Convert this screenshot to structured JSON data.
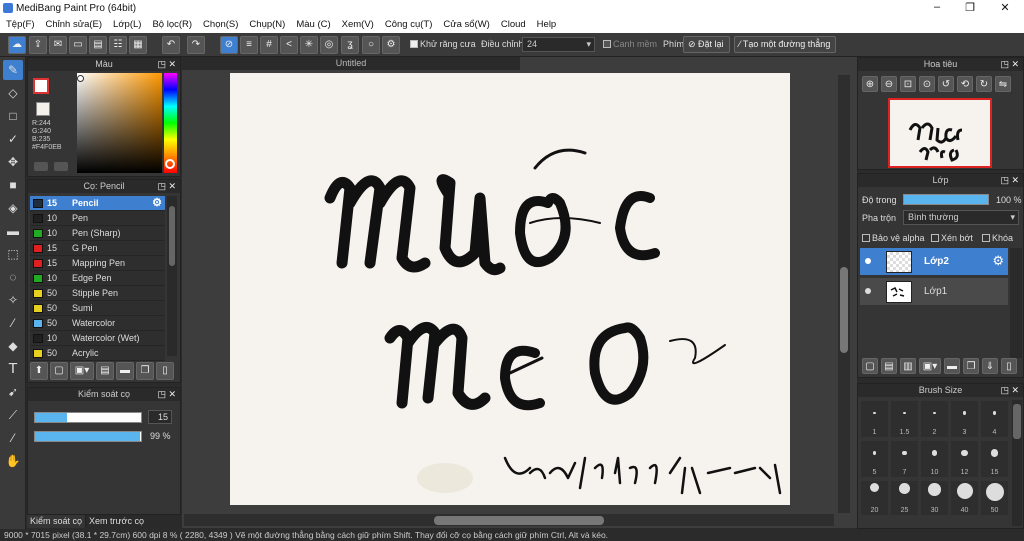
{
  "window": {
    "title": "MediBang Paint Pro (64bit)"
  },
  "menu": [
    "Tệp(F)",
    "Chỉnh sửa(E)",
    "Lớp(L)",
    "Bộ lọc(R)",
    "Chọn(S)",
    "Chụp(N)",
    "Màu (C)",
    "Xem(V)",
    "Công cụ(T)",
    "Cửa sổ(W)",
    "Cloud",
    "Help"
  ],
  "toolbar": {
    "antialias": "Khử răng cưa",
    "correction_label": "Điều chỉnh",
    "correction_value": "24",
    "edge_mode": "Canh mềm",
    "key_label": "Phím",
    "reset": "Đặt lại",
    "straight_line": "Tạo một đường thẳng"
  },
  "color_panel": {
    "title": "Màu",
    "r": "R:244",
    "g": "G:240",
    "b": "B:235",
    "hex": "#F4F0EB",
    "fg": "#F4F0EB"
  },
  "brush_panel": {
    "title": "Cọ: Pencil",
    "items": [
      {
        "size": "15",
        "name": "Pencil",
        "color": "#1e2e3e"
      },
      {
        "size": "10",
        "name": "Pen",
        "color": "#202020"
      },
      {
        "size": "10",
        "name": "Pen (Sharp)",
        "color": "#22aa22"
      },
      {
        "size": "15",
        "name": "G Pen",
        "color": "#e02020"
      },
      {
        "size": "15",
        "name": "Mapping Pen",
        "color": "#e02020"
      },
      {
        "size": "10",
        "name": "Edge Pen",
        "color": "#22aa22"
      },
      {
        "size": "50",
        "name": "Stipple Pen",
        "color": "#e8d020"
      },
      {
        "size": "50",
        "name": "Sumi",
        "color": "#e8d020"
      },
      {
        "size": "50",
        "name": "Watercolor",
        "color": "#5ab4ee"
      },
      {
        "size": "10",
        "name": "Watercolor (Wet)",
        "color": "#202020"
      },
      {
        "size": "50",
        "name": "Acrylic",
        "color": "#e8d020"
      }
    ]
  },
  "brush_control": {
    "title": "Kiểm soát cọ",
    "size": "15",
    "opacity": "99 %",
    "opacity_fraction": 0.99
  },
  "bottom_tabs": [
    "Kiểm soát cọ",
    "Xem trước cọ"
  ],
  "document": {
    "tab": "Untitled"
  },
  "navigator": {
    "title": "Hoa tiêu"
  },
  "layer_panel": {
    "title": "Lớp",
    "opacity_label": "Độ trong",
    "opacity_value": "100 %",
    "blend_label": "Pha trộn",
    "blend_value": "Bình thường",
    "protect_alpha": "Bảo vệ alpha",
    "clipping": "Xén bớt",
    "lock": "Khóa",
    "layers": [
      {
        "name": "Lớp2",
        "active": true
      },
      {
        "name": "Lớp1",
        "active": false
      }
    ]
  },
  "brush_size_panel": {
    "title": "Brush Size",
    "sizes": [
      "1",
      "1.5",
      "2",
      "3",
      "4",
      "5",
      "7",
      "10",
      "12",
      "15",
      "20",
      "25",
      "30",
      "40",
      "50"
    ]
  },
  "status": "9000 * 7015 pixel   (38.1 * 29.7cm)   600 dpi   8 %   ( 2280, 4349 )   Vẽ một đường thẳng bằng cách giữ phím Shift. Thay đổi cỡ cọ bằng cách giữ phím Ctrl, Alt và kéo."
}
